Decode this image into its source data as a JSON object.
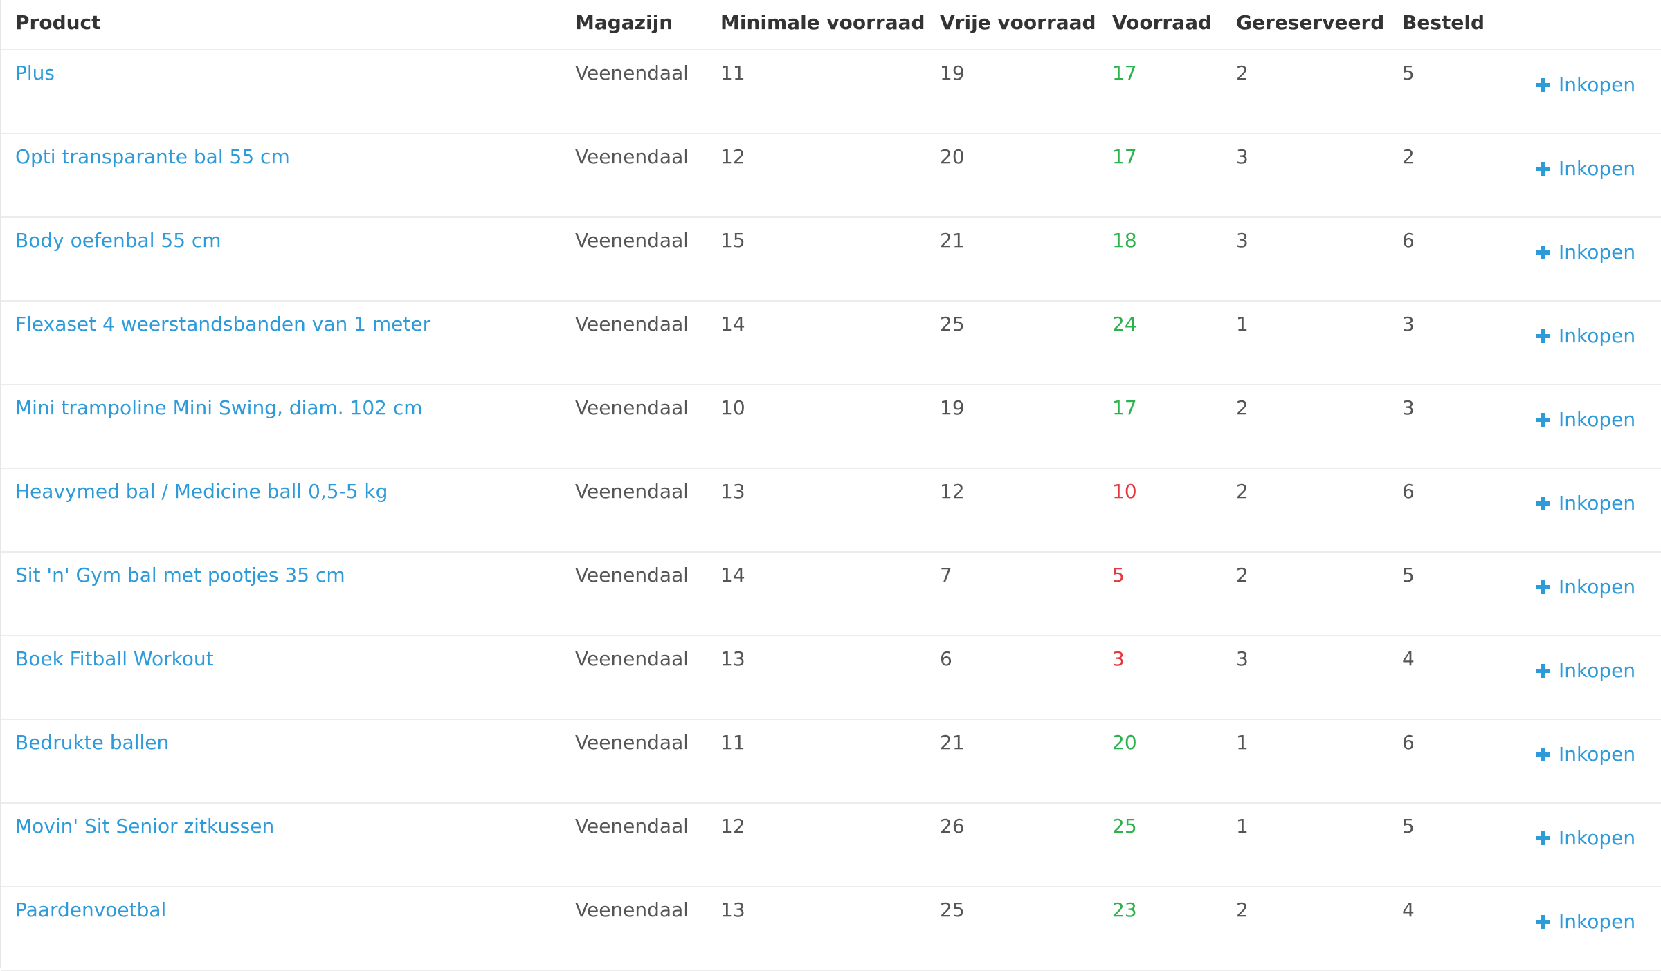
{
  "table": {
    "headers": {
      "product": "Product",
      "magazijn": "Magazijn",
      "minimale_voorraad": "Minimale voorraad",
      "vrije_voorraad": "Vrije voorraad",
      "voorraad": "Voorraad",
      "gereserveerd": "Gereserveerd",
      "besteld": "Besteld"
    },
    "action_label": "Inkopen",
    "action_icon": "plus-icon",
    "colors": {
      "link": "#2d9ad9",
      "stock_ok": "#2bb24c",
      "stock_low": "#e8363f"
    },
    "rows": [
      {
        "product": "Plus",
        "magazijn": "Veenendaal",
        "minimale_voorraad": "11",
        "vrije_voorraad": "19",
        "voorraad": "17",
        "gereserveerd": "2",
        "besteld": "5",
        "status": "ok"
      },
      {
        "product": "Opti transparante bal 55 cm",
        "magazijn": "Veenendaal",
        "minimale_voorraad": "12",
        "vrije_voorraad": "20",
        "voorraad": "17",
        "gereserveerd": "3",
        "besteld": "2",
        "status": "ok"
      },
      {
        "product": "Body oefenbal 55 cm",
        "magazijn": "Veenendaal",
        "minimale_voorraad": "15",
        "vrije_voorraad": "21",
        "voorraad": "18",
        "gereserveerd": "3",
        "besteld": "6",
        "status": "ok"
      },
      {
        "product": "Flexaset 4 weerstandsbanden van 1 meter",
        "magazijn": "Veenendaal",
        "minimale_voorraad": "14",
        "vrije_voorraad": "25",
        "voorraad": "24",
        "gereserveerd": "1",
        "besteld": "3",
        "status": "ok"
      },
      {
        "product": "Mini trampoline Mini Swing, diam. 102 cm",
        "magazijn": "Veenendaal",
        "minimale_voorraad": "10",
        "vrije_voorraad": "19",
        "voorraad": "17",
        "gereserveerd": "2",
        "besteld": "3",
        "status": "ok"
      },
      {
        "product": "Heavymed bal / Medicine ball 0,5-5 kg",
        "magazijn": "Veenendaal",
        "minimale_voorraad": "13",
        "vrije_voorraad": "12",
        "voorraad": "10",
        "gereserveerd": "2",
        "besteld": "6",
        "status": "low"
      },
      {
        "product": "Sit 'n' Gym bal met pootjes 35 cm",
        "magazijn": "Veenendaal",
        "minimale_voorraad": "14",
        "vrije_voorraad": "7",
        "voorraad": "5",
        "gereserveerd": "2",
        "besteld": "5",
        "status": "low"
      },
      {
        "product": "Boek Fitball Workout",
        "magazijn": "Veenendaal",
        "minimale_voorraad": "13",
        "vrije_voorraad": "6",
        "voorraad": "3",
        "gereserveerd": "3",
        "besteld": "4",
        "status": "low"
      },
      {
        "product": "Bedrukte ballen",
        "magazijn": "Veenendaal",
        "minimale_voorraad": "11",
        "vrije_voorraad": "21",
        "voorraad": "20",
        "gereserveerd": "1",
        "besteld": "6",
        "status": "ok"
      },
      {
        "product": "Movin' Sit Senior zitkussen",
        "magazijn": "Veenendaal",
        "minimale_voorraad": "12",
        "vrije_voorraad": "26",
        "voorraad": "25",
        "gereserveerd": "1",
        "besteld": "5",
        "status": "ok"
      },
      {
        "product": "Paardenvoetbal",
        "magazijn": "Veenendaal",
        "minimale_voorraad": "13",
        "vrije_voorraad": "25",
        "voorraad": "23",
        "gereserveerd": "2",
        "besteld": "4",
        "status": "ok"
      }
    ]
  }
}
